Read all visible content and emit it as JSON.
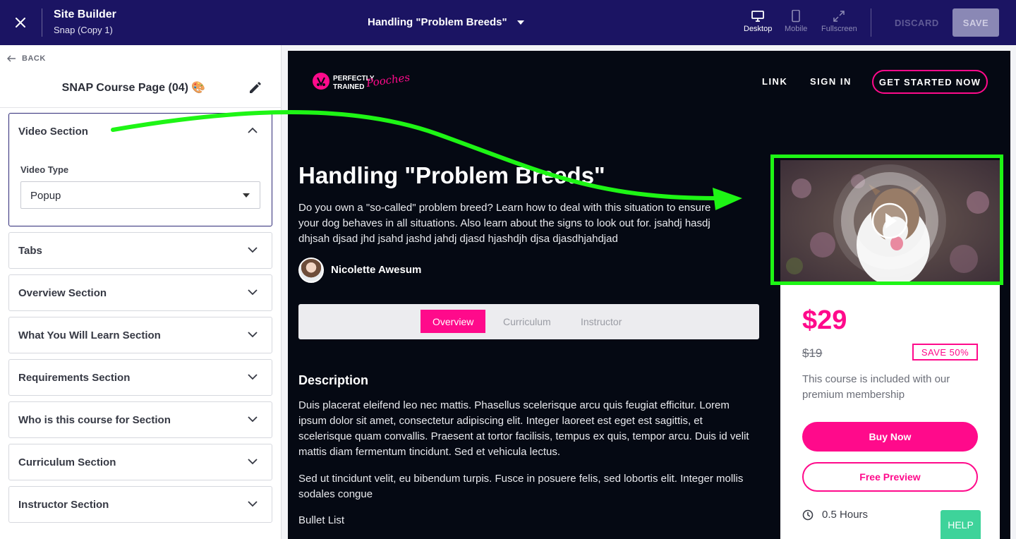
{
  "topbar": {
    "app_title": "Site Builder",
    "site_name": "Snap (Copy 1)",
    "page_name": "Handling \"Problem Breeds\"",
    "devices": {
      "desktop": "Desktop",
      "mobile": "Mobile",
      "fullscreen": "Fullscreen"
    },
    "discard_label": "DISCARD",
    "save_label": "SAVE"
  },
  "left_panel": {
    "back_label": "BACK",
    "title": "SNAP Course Page (04) 🎨",
    "sections": [
      {
        "label": "Video Section",
        "expanded": true
      },
      {
        "label": "Tabs"
      },
      {
        "label": "Overview Section"
      },
      {
        "label": "What You Will Learn Section"
      },
      {
        "label": "Requirements Section"
      },
      {
        "label": "Who is this course for Section"
      },
      {
        "label": "Curriculum Section"
      },
      {
        "label": "Instructor Section"
      }
    ],
    "video_type": {
      "label": "Video Type",
      "value": "Popup"
    }
  },
  "preview": {
    "logo": {
      "line1": "PERFECTLY",
      "line2": "TRAINED",
      "script": "Pooches"
    },
    "nav": {
      "link": "LINK",
      "sign_in": "SIGN IN",
      "cta": "GET STARTED NOW"
    },
    "hero": {
      "title": "Handling \"Problem Breeds\"",
      "description": "Do you own a \"so-called\" problem breed? Learn how to deal with this situation to ensure your dog behaves in all situations. Also learn about the signs to look out for. jsahdj hasdj dhjsah djsad jhd jsahd jashd jahdj djasd hjashdjh djsa djasdhjahdjad",
      "author": "Nicolette Awesum"
    },
    "tabs": [
      "Overview",
      "Curriculum",
      "Instructor"
    ],
    "description": {
      "heading": "Description",
      "p1": "Duis placerat eleifend leo nec mattis. Phasellus scelerisque arcu quis feugiat efficitur. Lorem ipsum dolor sit amet, consectetur adipiscing elit. Integer laoreet est eget est sagittis, et scelerisque quam convallis. Praesent at tortor facilisis, tempus ex quis, tempor arcu. Duis id velit mattis diam fermentum tincidunt. Sed et vehicula lectus.",
      "p2": "Sed ut tincidunt velit, eu bibendum turpis. Fusce in posuere felis, sed lobortis elit. Integer mollis sodales congue",
      "bullet": "Bullet List"
    },
    "card": {
      "price": "$29",
      "old_price": "$19",
      "save_badge": "SAVE 50%",
      "included": "This course is included with our premium membership",
      "buy": "Buy Now",
      "free_preview": "Free Preview",
      "duration": "0.5 Hours"
    }
  },
  "help_label": "HELP",
  "colors": {
    "topbar": "#1b1463",
    "brand_pink": "#ff0a8b",
    "annotation_green": "#1ef515",
    "help_green": "#3ed39a"
  }
}
